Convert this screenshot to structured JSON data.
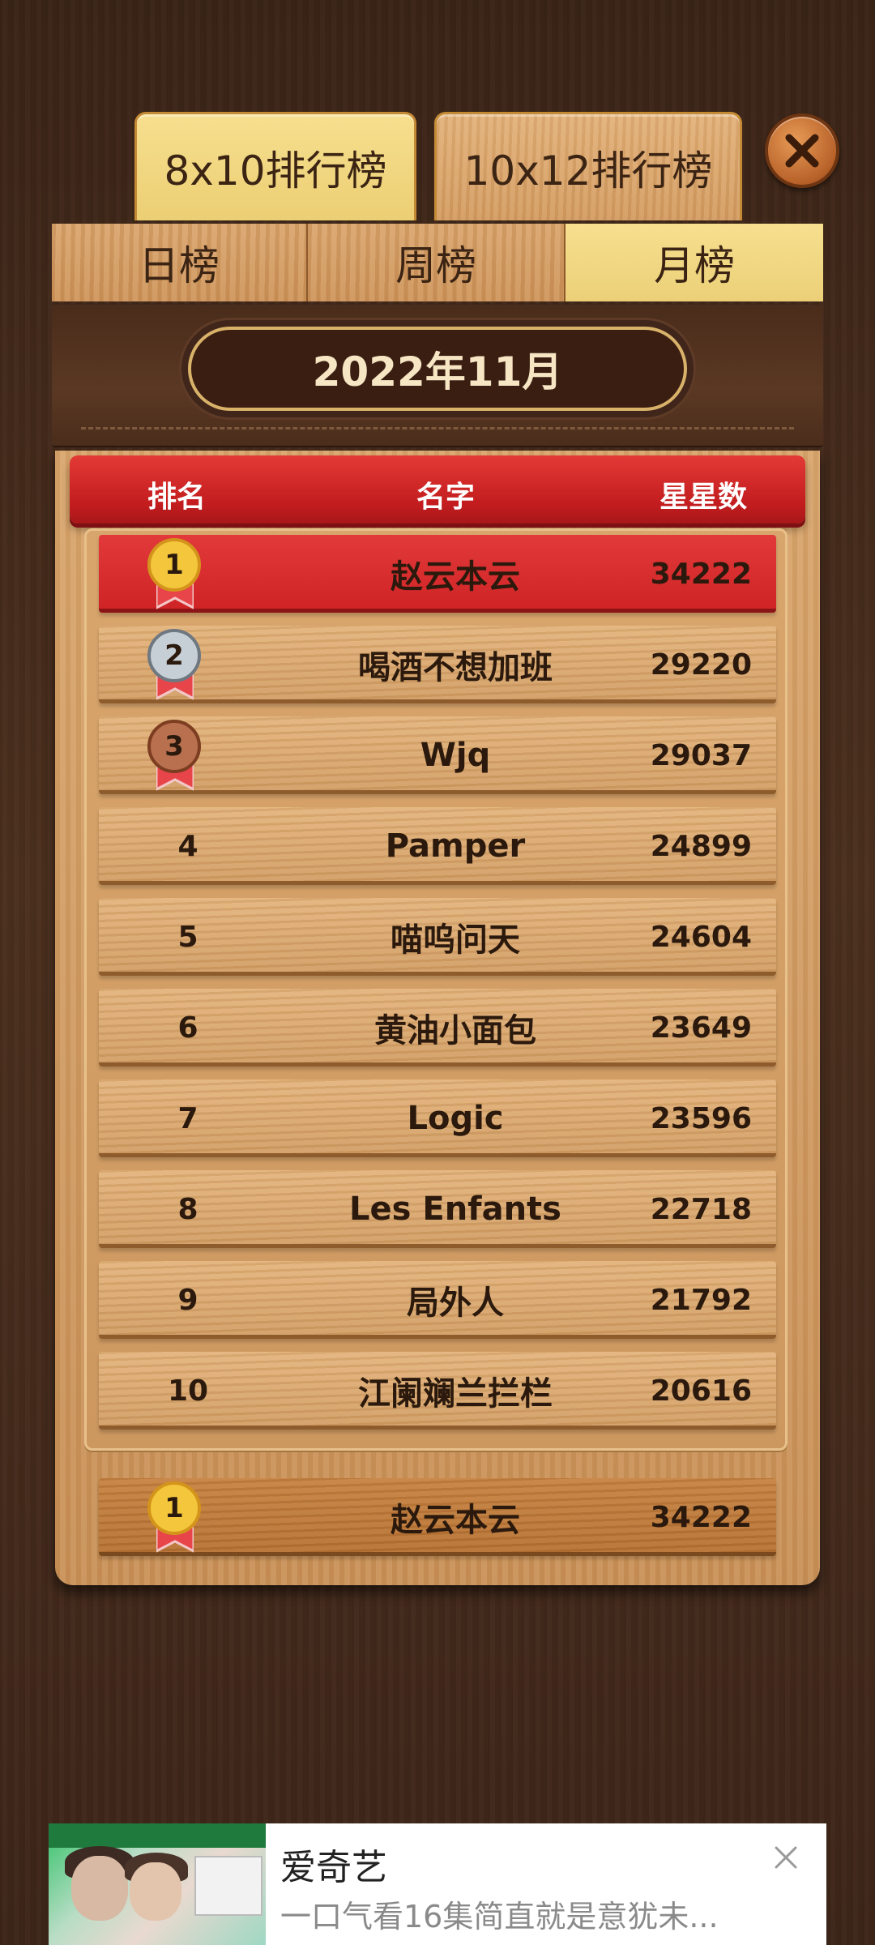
{
  "board_tabs": [
    {
      "label": "8x10排行榜",
      "active": true
    },
    {
      "label": "10x12排行榜",
      "active": false
    }
  ],
  "period_tabs": [
    {
      "label": "日榜",
      "active": false
    },
    {
      "label": "周榜",
      "active": false
    },
    {
      "label": "月榜",
      "active": true
    }
  ],
  "period_title": "2022年11月",
  "columns": {
    "rank": "排名",
    "name": "名字",
    "stars": "星星数"
  },
  "rows": [
    {
      "rank": "1",
      "name": "赵云本云",
      "stars": "34222"
    },
    {
      "rank": "2",
      "name": "喝酒不想加班",
      "stars": "29220"
    },
    {
      "rank": "3",
      "name": "Wjq",
      "stars": "29037"
    },
    {
      "rank": "4",
      "name": "Pamper",
      "stars": "24899"
    },
    {
      "rank": "5",
      "name": "喵呜问天",
      "stars": "24604"
    },
    {
      "rank": "6",
      "name": "黄油小面包",
      "stars": "23649"
    },
    {
      "rank": "7",
      "name": "Logic",
      "stars": "23596"
    },
    {
      "rank": "8",
      "name": "Les Enfants",
      "stars": "22718"
    },
    {
      "rank": "9",
      "name": "局外人",
      "stars": "21792"
    },
    {
      "rank": "10",
      "name": "江阑斓兰拦栏",
      "stars": "20616"
    }
  ],
  "my_rank": {
    "rank": "1",
    "name": "赵云本云",
    "stars": "34222"
  },
  "ad": {
    "title": "爱奇艺",
    "description": "一口气看16集简直就是意犹未..."
  },
  "icons": {
    "close": "close-icon",
    "medal_gold": "gold-medal-icon",
    "medal_silver": "silver-medal-icon",
    "medal_bronze": "bronze-medal-icon",
    "ad_close": "close-icon"
  },
  "colors": {
    "gold": "#f2c33a",
    "silver": "#b9c3cc",
    "bronze": "#b4684a",
    "header_red": "#c41d1f",
    "active_tab": "#f3da85"
  }
}
